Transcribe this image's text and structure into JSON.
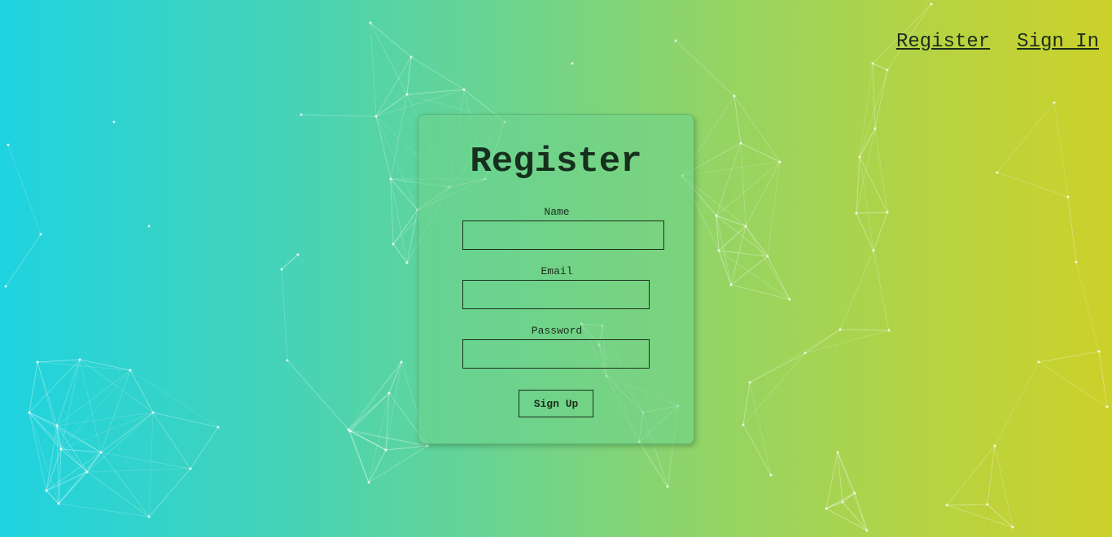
{
  "nav": {
    "register_label": "Register",
    "signin_label": "Sign In"
  },
  "form": {
    "title": "Register",
    "name_label": "Name",
    "name_value": "",
    "email_label": "Email",
    "email_value": "",
    "password_label": "Password",
    "password_value": "",
    "submit_label": "Sign Up"
  },
  "colors": {
    "gradient_left": "#1fd3e0",
    "gradient_right": "#ccd12a",
    "text": "#1b2d1c",
    "mesh_line": "#ffffff"
  }
}
